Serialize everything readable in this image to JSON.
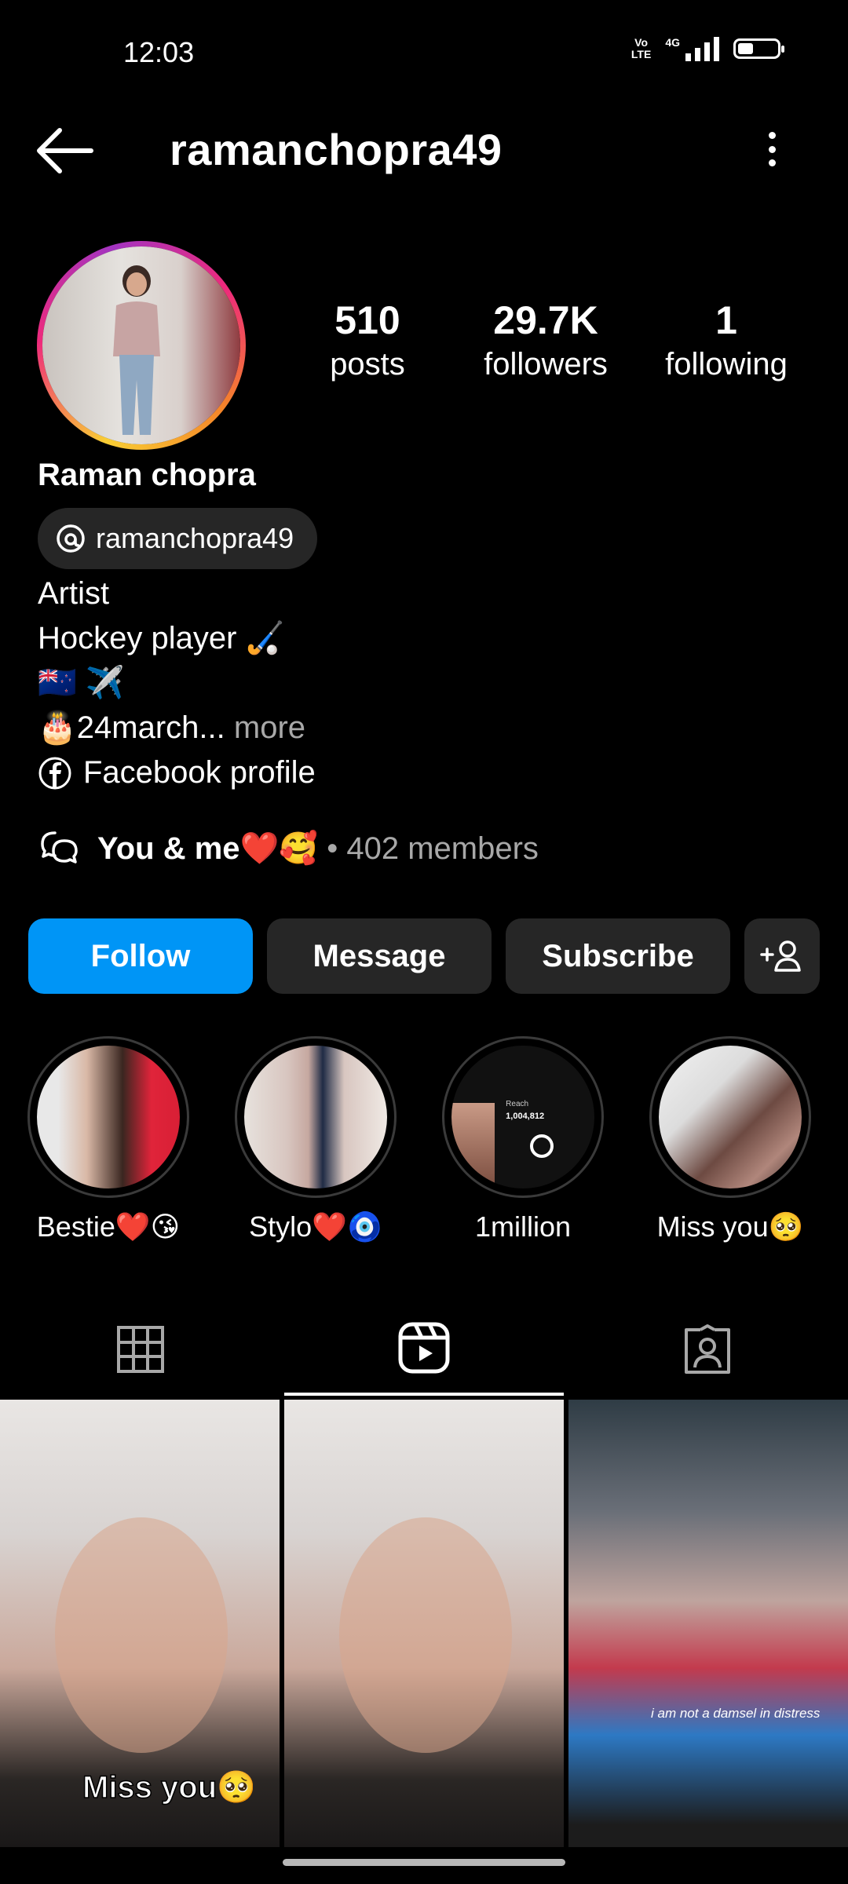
{
  "status_bar": {
    "time": "12:03",
    "volte_top": "Vo",
    "volte_bottom": "LTE",
    "network": "4G",
    "battery_level": 0.4
  },
  "header": {
    "username": "ramanchopra49"
  },
  "profile": {
    "stats": [
      {
        "value": "510",
        "label": "posts"
      },
      {
        "value": "29.7K",
        "label": "followers"
      },
      {
        "value": "1",
        "label": "following"
      }
    ],
    "full_name": "Raman chopra",
    "threads_handle": "ramanchopra49",
    "bio": {
      "line1": "Artist",
      "line2": "Hockey player 🏑",
      "line3": "🇳🇿 ✈️",
      "line4": "🎂24march...",
      "more": " more",
      "link": "Facebook profile"
    },
    "channel": {
      "name": "You & me❤️🥰",
      "members": " • 402 members"
    }
  },
  "actions": {
    "follow": "Follow",
    "message": "Message",
    "subscribe": "Subscribe"
  },
  "highlights": [
    {
      "label": "Bestie❤️😘"
    },
    {
      "label": "Stylo❤️🧿"
    },
    {
      "label": "1million"
    },
    {
      "label": "Miss you🥺"
    }
  ],
  "highlight_overlay": {
    "reach_label": "Reach",
    "reach_value": "1,004,812"
  },
  "tabs": {
    "active": "reels"
  },
  "posts": [
    {
      "caption": "Miss you🥺"
    },
    {
      "caption": ""
    },
    {
      "caption": "i am not a damsel in distress"
    }
  ],
  "colors": {
    "accent": "#0095f6",
    "button_bg": "#262626",
    "muted_text": "#a8a8a8"
  }
}
